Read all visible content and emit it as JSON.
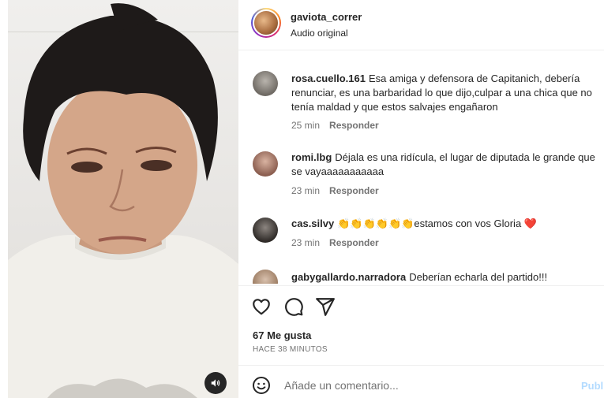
{
  "post": {
    "username": "gaviota_correr",
    "audio_label": "Audio original"
  },
  "comments": [
    {
      "user": "rosa.cuello.161",
      "text": "Esa amiga y defensora de Capitanich, debería renunciar, es una barbaridad lo que dijo,culpar a una chica que no tenía maldad y que estos salvajes engañaron",
      "time": "25 min",
      "reply": "Responder"
    },
    {
      "user": "romi.lbg",
      "text": "Déjala es una ridícula, el lugar de diputada le grande que se vayaaaaaaaaaaa",
      "time": "23 min",
      "reply": "Responder"
    },
    {
      "user": "cas.silvy",
      "text": "👏👏👏👏👏👏estamos con vos Gloria ❤️",
      "time": "23 min",
      "reply": "Responder"
    },
    {
      "user": "gabygallardo.narradora",
      "text": "Deberían echarla del partido!!!",
      "time": "",
      "reply": ""
    }
  ],
  "likes_label": "67 Me gusta",
  "time_ago": "HACE 38 MINUTOS",
  "add_comment": {
    "placeholder": "Añade un comentario...",
    "post_label": "Publicar"
  },
  "icons": {
    "like": "heart-icon",
    "comment": "comment-icon",
    "share": "share-icon",
    "emoji": "emoji-icon",
    "mute": "volume-icon"
  },
  "colors": {
    "accent": "#0095f6",
    "post_disabled": "#b3dbff",
    "secondary_text": "#737373"
  }
}
